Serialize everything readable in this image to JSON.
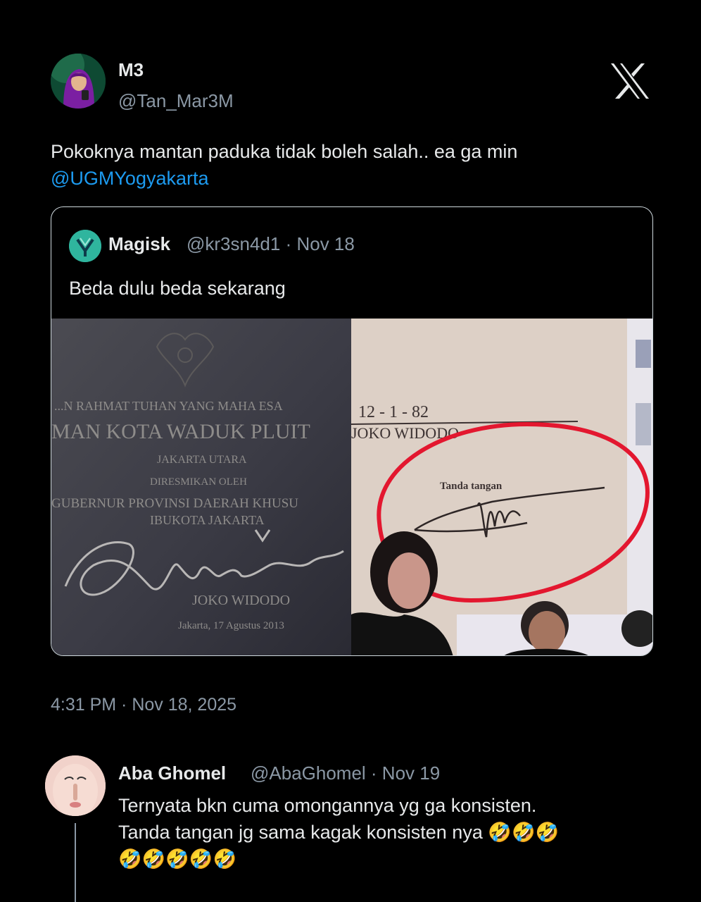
{
  "tweet": {
    "author_name": "M3",
    "author_handle": "@Tan_Mar3M",
    "text": "Pokoknya mantan paduka tidak boleh salah.. ea ga min",
    "mention": "@UGMYogyakarta",
    "timestamp": "4:31 PM · Nov 18, 2025"
  },
  "quote": {
    "author_name": "Magisk",
    "meta": "@kr3sn4d1 · Nov 18",
    "text": "Beda dulu beda sekarang",
    "images": {
      "left_plaque_lines": [
        "...N RAHMAT TUHAN YANG MAHA ESA",
        "MAN KOTA WADUK PLUIT",
        "JAKARTA UTARA",
        "DIRESMIKAN OLEH",
        "GUBERNUR PROVINSI DAERAH KHUSU",
        "IBUKOTA JAKARTA",
        "JOKO WIDODO",
        "Jakarta, 17 Agustus 2013"
      ],
      "right_document_lines": [
        "12 - 1 - 82",
        "JOKO WIDODO",
        "Tanda tangan"
      ]
    }
  },
  "reply": {
    "author_name": "Aba Ghomel",
    "meta": "@AbaGhomel · Nov 19",
    "text_line1": "Ternyata bkn cuma omongannya yg ga konsisten.",
    "text_line2": "Tanda tangan jg sama kagak konsisten nya",
    "emojis_line2": "🤣🤣🤣",
    "emojis_line3": "🤣🤣🤣🤣🤣"
  },
  "colors": {
    "background": "#000000",
    "text_primary": "#e7e9ea",
    "text_secondary": "#8b98a5",
    "link": "#1d9bf0",
    "circle_annotation": "#e3172f"
  }
}
